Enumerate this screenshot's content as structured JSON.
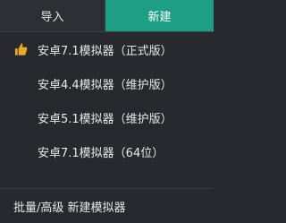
{
  "tabs": {
    "import_label": "导入",
    "new_label": "新建"
  },
  "items": [
    {
      "label": "安卓7.1模拟器（正式版）",
      "icon": "thumbs-up-icon",
      "recommended": true
    },
    {
      "label": "安卓4.4模拟器（维护版）"
    },
    {
      "label": "安卓5.1模拟器（维护版）"
    },
    {
      "label": "安卓7.1模拟器（64位）"
    }
  ],
  "footer": {
    "label": "批量/高级 新建模拟器"
  },
  "colors": {
    "accent": "#1e9e85",
    "thumb": "#e9a825",
    "background": "#27292e"
  }
}
